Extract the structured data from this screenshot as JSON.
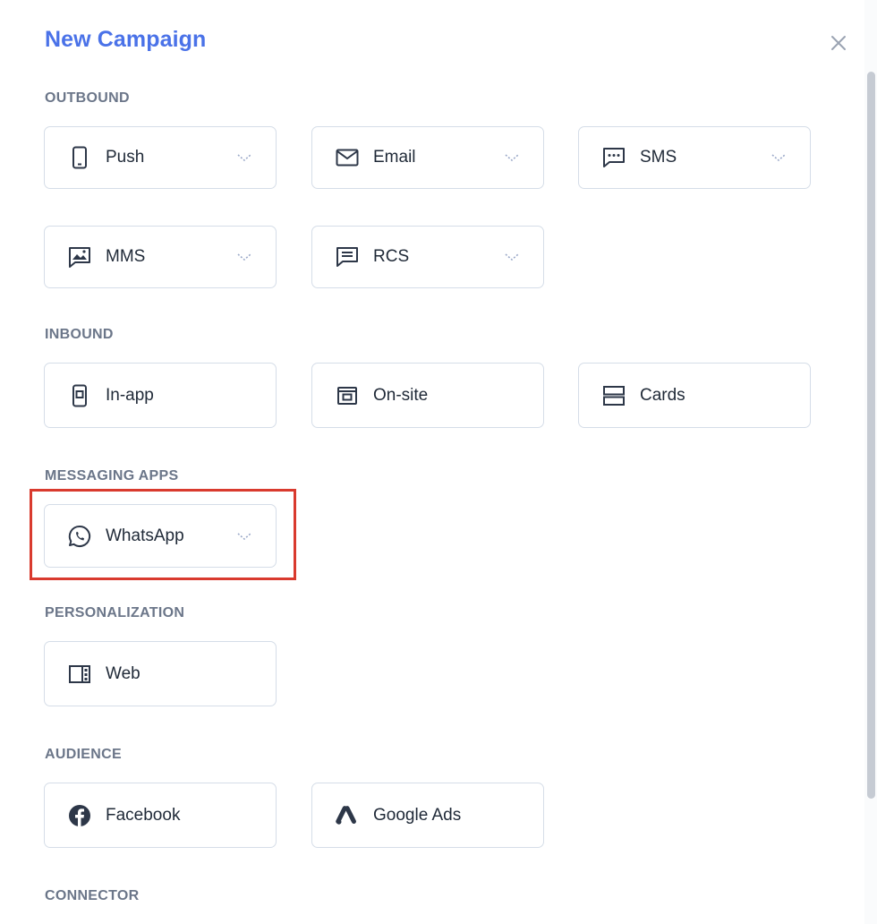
{
  "dialog": {
    "title": "New Campaign",
    "accent_color": "#4a72e8",
    "highlight_color": "#d93a2e"
  },
  "sections": {
    "outbound": {
      "label": "OUTBOUND",
      "items": [
        {
          "label": "Push",
          "icon": "smartphone-icon",
          "has_dropdown": true
        },
        {
          "label": "Email",
          "icon": "envelope-icon",
          "has_dropdown": true
        },
        {
          "label": "SMS",
          "icon": "chat-bubble-icon",
          "has_dropdown": true
        },
        {
          "label": "MMS",
          "icon": "image-icon",
          "has_dropdown": true
        },
        {
          "label": "RCS",
          "icon": "message-lines-icon",
          "has_dropdown": true
        }
      ]
    },
    "inbound": {
      "label": "INBOUND",
      "items": [
        {
          "label": "In-app",
          "icon": "in-app-icon",
          "has_dropdown": false
        },
        {
          "label": "On-site",
          "icon": "browser-window-icon",
          "has_dropdown": false
        },
        {
          "label": "Cards",
          "icon": "cards-stack-icon",
          "has_dropdown": false
        }
      ]
    },
    "messaging_apps": {
      "label": "MESSAGING APPS",
      "items": [
        {
          "label": "WhatsApp",
          "icon": "whatsapp-icon",
          "has_dropdown": true
        }
      ]
    },
    "personalization": {
      "label": "PERSONALIZATION",
      "items": [
        {
          "label": "Web",
          "icon": "web-layout-icon",
          "has_dropdown": false
        }
      ]
    },
    "audience": {
      "label": "AUDIENCE",
      "items": [
        {
          "label": "Facebook",
          "icon": "facebook-icon",
          "has_dropdown": false
        },
        {
          "label": "Google Ads",
          "icon": "google-ads-icon",
          "has_dropdown": false
        }
      ]
    },
    "connector": {
      "label": "CONNECTOR"
    }
  }
}
